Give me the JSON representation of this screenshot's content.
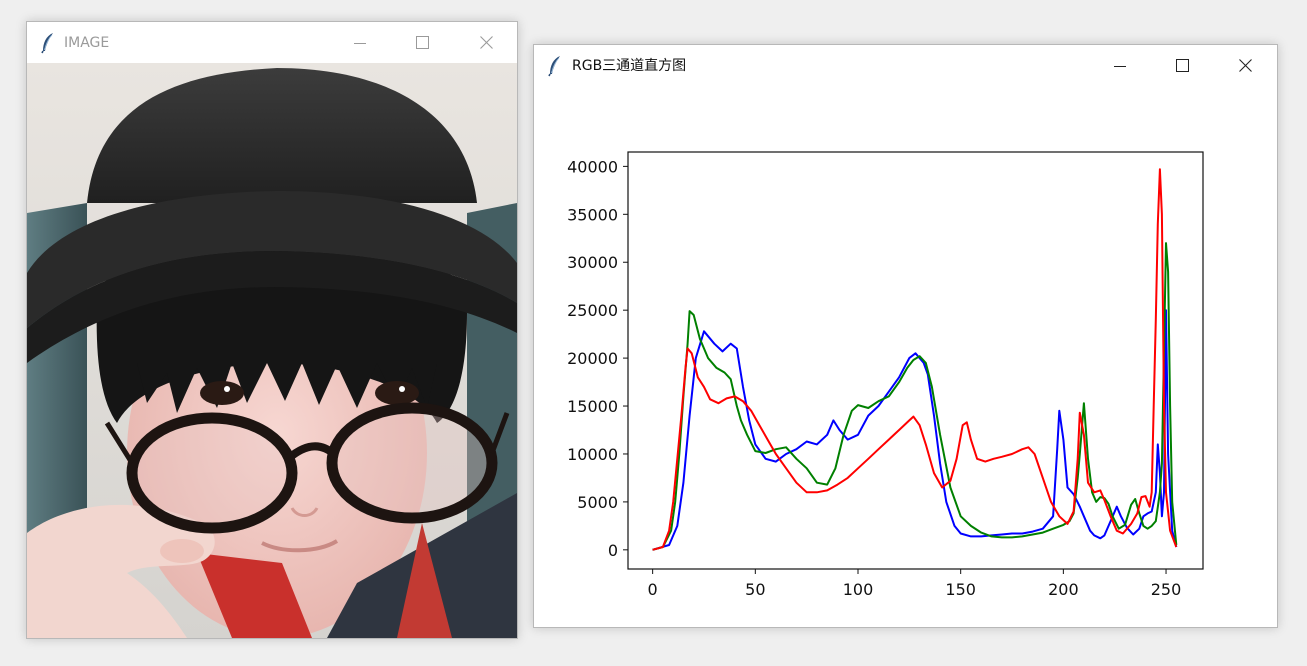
{
  "windows": {
    "image": {
      "title": "IMAGE",
      "icon": "feather-icon",
      "controls": [
        "minimize-icon",
        "maximize-icon",
        "close-icon"
      ]
    },
    "histogram": {
      "title": "RGB三通道直方图",
      "icon": "feather-icon",
      "controls": [
        "minimize-icon",
        "maximize-icon",
        "close-icon"
      ]
    }
  },
  "chart_data": {
    "type": "line",
    "title": "",
    "xlabel": "",
    "ylabel": "",
    "xlim": [
      -12,
      268
    ],
    "ylim": [
      -2000,
      41500
    ],
    "xticks": [
      0,
      50,
      100,
      150,
      200,
      250
    ],
    "yticks": [
      0,
      5000,
      10000,
      15000,
      20000,
      25000,
      30000,
      35000,
      40000
    ],
    "grid": false,
    "legend": "none",
    "series": [
      {
        "color": "#0000ff",
        "points": [
          [
            0,
            0
          ],
          [
            8,
            500
          ],
          [
            12,
            2500
          ],
          [
            15,
            7000
          ],
          [
            18,
            14000
          ],
          [
            21,
            20000
          ],
          [
            25,
            22800
          ],
          [
            30,
            21500
          ],
          [
            34,
            20700
          ],
          [
            38,
            21500
          ],
          [
            41,
            21000
          ],
          [
            44,
            17000
          ],
          [
            47,
            13500
          ],
          [
            50,
            11000
          ],
          [
            55,
            9500
          ],
          [
            60,
            9200
          ],
          [
            65,
            10000
          ],
          [
            70,
            10500
          ],
          [
            75,
            11300
          ],
          [
            80,
            11000
          ],
          [
            85,
            12000
          ],
          [
            88,
            13500
          ],
          [
            91,
            12500
          ],
          [
            95,
            11500
          ],
          [
            100,
            12000
          ],
          [
            105,
            14000
          ],
          [
            110,
            15000
          ],
          [
            115,
            16500
          ],
          [
            120,
            18000
          ],
          [
            125,
            20000
          ],
          [
            128,
            20500
          ],
          [
            132,
            19500
          ],
          [
            134,
            18300
          ],
          [
            137,
            14000
          ],
          [
            140,
            9000
          ],
          [
            143,
            5000
          ],
          [
            147,
            2500
          ],
          [
            150,
            1700
          ],
          [
            155,
            1400
          ],
          [
            160,
            1400
          ],
          [
            165,
            1500
          ],
          [
            170,
            1600
          ],
          [
            175,
            1700
          ],
          [
            180,
            1700
          ],
          [
            185,
            1900
          ],
          [
            190,
            2200
          ],
          [
            195,
            3500
          ],
          [
            197,
            10500
          ],
          [
            198,
            14500
          ],
          [
            200,
            11500
          ],
          [
            202,
            6500
          ],
          [
            205,
            5800
          ],
          [
            208,
            4500
          ],
          [
            210,
            3500
          ],
          [
            213,
            2000
          ],
          [
            215,
            1500
          ],
          [
            218,
            1200
          ],
          [
            220,
            1500
          ],
          [
            223,
            3000
          ],
          [
            226,
            4500
          ],
          [
            228,
            3500
          ],
          [
            231,
            2300
          ],
          [
            234,
            1600
          ],
          [
            237,
            2200
          ],
          [
            239,
            3500
          ],
          [
            241,
            3800
          ],
          [
            243,
            4000
          ],
          [
            245,
            6000
          ],
          [
            246,
            11000
          ],
          [
            247,
            8000
          ],
          [
            248,
            3500
          ],
          [
            249,
            6000
          ],
          [
            250,
            25000
          ],
          [
            251,
            10000
          ],
          [
            253,
            2000
          ],
          [
            255,
            300
          ]
        ]
      },
      {
        "color": "#008000",
        "points": [
          [
            0,
            0
          ],
          [
            5,
            300
          ],
          [
            9,
            2000
          ],
          [
            11,
            5000
          ],
          [
            13,
            10000
          ],
          [
            15,
            16000
          ],
          [
            17,
            21500
          ],
          [
            18,
            24900
          ],
          [
            20,
            24500
          ],
          [
            23,
            22000
          ],
          [
            27,
            20000
          ],
          [
            31,
            19000
          ],
          [
            35,
            18500
          ],
          [
            38,
            17800
          ],
          [
            41,
            15000
          ],
          [
            43,
            13500
          ],
          [
            46,
            12000
          ],
          [
            50,
            10300
          ],
          [
            55,
            10100
          ],
          [
            60,
            10500
          ],
          [
            65,
            10700
          ],
          [
            70,
            9500
          ],
          [
            75,
            8500
          ],
          [
            80,
            7000
          ],
          [
            85,
            6800
          ],
          [
            89,
            8500
          ],
          [
            93,
            12000
          ],
          [
            97,
            14500
          ],
          [
            100,
            15100
          ],
          [
            105,
            14800
          ],
          [
            110,
            15500
          ],
          [
            115,
            16000
          ],
          [
            120,
            17500
          ],
          [
            124,
            19000
          ],
          [
            127,
            19800
          ],
          [
            130,
            20200
          ],
          [
            133,
            19500
          ],
          [
            136,
            17000
          ],
          [
            140,
            12000
          ],
          [
            145,
            6500
          ],
          [
            150,
            3500
          ],
          [
            155,
            2500
          ],
          [
            160,
            1800
          ],
          [
            165,
            1400
          ],
          [
            170,
            1300
          ],
          [
            175,
            1300
          ],
          [
            180,
            1400
          ],
          [
            185,
            1600
          ],
          [
            190,
            1800
          ],
          [
            195,
            2200
          ],
          [
            200,
            2600
          ],
          [
            203,
            3000
          ],
          [
            205,
            3800
          ],
          [
            207,
            7500
          ],
          [
            208,
            10000
          ],
          [
            210,
            15300
          ],
          [
            212,
            9500
          ],
          [
            214,
            6000
          ],
          [
            216,
            5000
          ],
          [
            218,
            5500
          ],
          [
            220,
            5400
          ],
          [
            222,
            4800
          ],
          [
            224,
            3500
          ],
          [
            227,
            2200
          ],
          [
            230,
            2600
          ],
          [
            233,
            4700
          ],
          [
            235,
            5300
          ],
          [
            237,
            3800
          ],
          [
            239,
            2500
          ],
          [
            241,
            2200
          ],
          [
            243,
            2500
          ],
          [
            245,
            3000
          ],
          [
            247,
            6000
          ],
          [
            248,
            9000
          ],
          [
            250,
            32000
          ],
          [
            251,
            29000
          ],
          [
            252,
            15000
          ],
          [
            253,
            5000
          ],
          [
            255,
            500
          ]
        ]
      },
      {
        "color": "#ff0000",
        "points": [
          [
            0,
            0
          ],
          [
            5,
            300
          ],
          [
            8,
            2000
          ],
          [
            10,
            5000
          ],
          [
            12,
            9500
          ],
          [
            14,
            14000
          ],
          [
            16,
            19000
          ],
          [
            17,
            21000
          ],
          [
            19,
            20500
          ],
          [
            22,
            18000
          ],
          [
            25,
            17000
          ],
          [
            28,
            15700
          ],
          [
            32,
            15300
          ],
          [
            36,
            15800
          ],
          [
            40,
            16000
          ],
          [
            44,
            15500
          ],
          [
            48,
            14500
          ],
          [
            52,
            13000
          ],
          [
            56,
            11500
          ],
          [
            60,
            10000
          ],
          [
            65,
            8500
          ],
          [
            70,
            7000
          ],
          [
            75,
            6000
          ],
          [
            80,
            6000
          ],
          [
            85,
            6200
          ],
          [
            90,
            6800
          ],
          [
            95,
            7500
          ],
          [
            100,
            8500
          ],
          [
            105,
            9500
          ],
          [
            110,
            10500
          ],
          [
            115,
            11500
          ],
          [
            120,
            12500
          ],
          [
            125,
            13500
          ],
          [
            127,
            13900
          ],
          [
            130,
            13000
          ],
          [
            133,
            11000
          ],
          [
            137,
            8000
          ],
          [
            141,
            6500
          ],
          [
            145,
            7200
          ],
          [
            148,
            9500
          ],
          [
            151,
            13000
          ],
          [
            153,
            13300
          ],
          [
            155,
            11500
          ],
          [
            158,
            9500
          ],
          [
            162,
            9200
          ],
          [
            166,
            9500
          ],
          [
            170,
            9700
          ],
          [
            175,
            10000
          ],
          [
            180,
            10500
          ],
          [
            183,
            10700
          ],
          [
            186,
            10000
          ],
          [
            190,
            7500
          ],
          [
            194,
            5000
          ],
          [
            198,
            3500
          ],
          [
            202,
            2700
          ],
          [
            205,
            4000
          ],
          [
            207,
            9500
          ],
          [
            208,
            14300
          ],
          [
            210,
            12000
          ],
          [
            212,
            7000
          ],
          [
            215,
            6000
          ],
          [
            218,
            6200
          ],
          [
            220,
            5200
          ],
          [
            223,
            3500
          ],
          [
            226,
            2000
          ],
          [
            229,
            1700
          ],
          [
            233,
            2700
          ],
          [
            236,
            3800
          ],
          [
            238,
            5500
          ],
          [
            240,
            5600
          ],
          [
            242,
            4500
          ],
          [
            243,
            6000
          ],
          [
            244,
            15000
          ],
          [
            245,
            24000
          ],
          [
            246,
            34000
          ],
          [
            247,
            39700
          ],
          [
            248,
            35000
          ],
          [
            249,
            15000
          ],
          [
            250,
            6000
          ],
          [
            252,
            2000
          ],
          [
            255,
            300
          ]
        ]
      }
    ]
  }
}
